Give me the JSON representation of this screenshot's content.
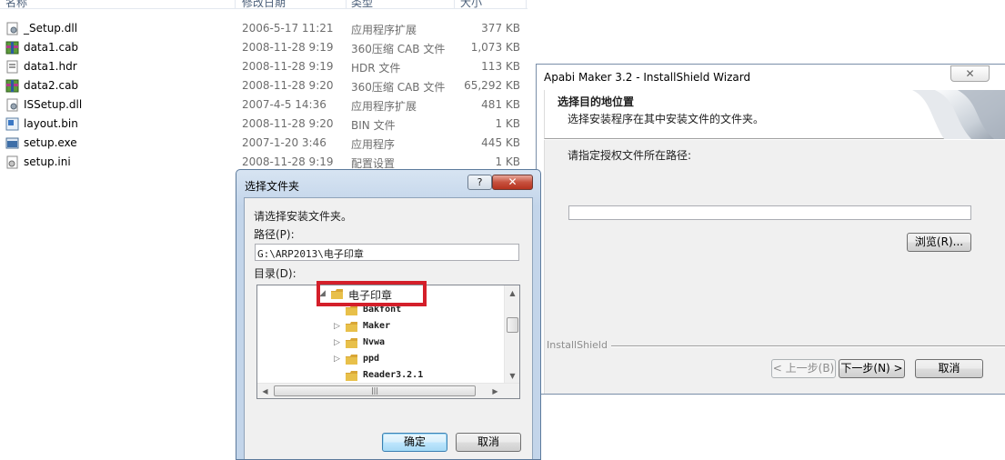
{
  "explorer": {
    "columns": {
      "name": "名称",
      "date": "修改日期",
      "type": "类型",
      "size": "大小"
    },
    "files": [
      {
        "name": "_Setup.dll",
        "date": "2006-5-17 11:21",
        "type": "应用程序扩展",
        "size": "377 KB",
        "icon": "dll-file-icon"
      },
      {
        "name": "data1.cab",
        "date": "2008-11-28 9:19",
        "type": "360压缩 CAB 文件",
        "size": "1,073 KB",
        "icon": "archive-file-icon"
      },
      {
        "name": "data1.hdr",
        "date": "2008-11-28 9:19",
        "type": "HDR 文件",
        "size": "113 KB",
        "icon": "generic-file-icon"
      },
      {
        "name": "data2.cab",
        "date": "2008-11-28 9:20",
        "type": "360压缩 CAB 文件",
        "size": "65,292 KB",
        "icon": "archive-file-icon"
      },
      {
        "name": "ISSetup.dll",
        "date": "2007-4-5 14:36",
        "type": "应用程序扩展",
        "size": "481 KB",
        "icon": "dll-file-icon"
      },
      {
        "name": "layout.bin",
        "date": "2008-11-28 9:20",
        "type": "BIN 文件",
        "size": "1 KB",
        "icon": "bin-file-icon"
      },
      {
        "name": "setup.exe",
        "date": "2007-1-20 3:46",
        "type": "应用程序",
        "size": "445 KB",
        "icon": "exe-file-icon"
      },
      {
        "name": "setup.ini",
        "date": "2008-11-28 9:19",
        "type": "配置设置",
        "size": "1 KB",
        "icon": "ini-file-icon"
      }
    ]
  },
  "wizard": {
    "title": "Apabi Maker 3.2 - InstallShield Wizard",
    "header_title": "选择目的地位置",
    "header_subtitle": "选择安装程序在其中安装文件的文件夹。",
    "prompt": "请指定授权文件所在路径:",
    "path_value": "",
    "browse_label": "浏览(R)...",
    "brand": "InstallShield",
    "back_label": "< 上一步(B)",
    "next_label": "下一步(N) >",
    "cancel_label": "取消"
  },
  "folder_dialog": {
    "title": "选择文件夹",
    "instruction": "请选择安装文件夹。",
    "path_label": "路径(P):",
    "path_value": "G:\\ARP2013\\电子印章",
    "dir_label": "目录(D):",
    "tree": [
      {
        "label": "电子印章",
        "selected": true,
        "expander": "◢",
        "indent": 0
      },
      {
        "label": "Bakfont",
        "selected": false,
        "expander": "",
        "indent": 1
      },
      {
        "label": "Maker",
        "selected": false,
        "expander": "▷",
        "indent": 1
      },
      {
        "label": "Nvwa",
        "selected": false,
        "expander": "▷",
        "indent": 1
      },
      {
        "label": "ppd",
        "selected": false,
        "expander": "▷",
        "indent": 1
      },
      {
        "label": "Reader3.2.1",
        "selected": false,
        "expander": "",
        "indent": 1
      }
    ],
    "ok_label": "确定",
    "cancel_label": "取消"
  },
  "colors": {
    "highlight_box": "#d41f2a",
    "folder": "#e8c04a"
  }
}
